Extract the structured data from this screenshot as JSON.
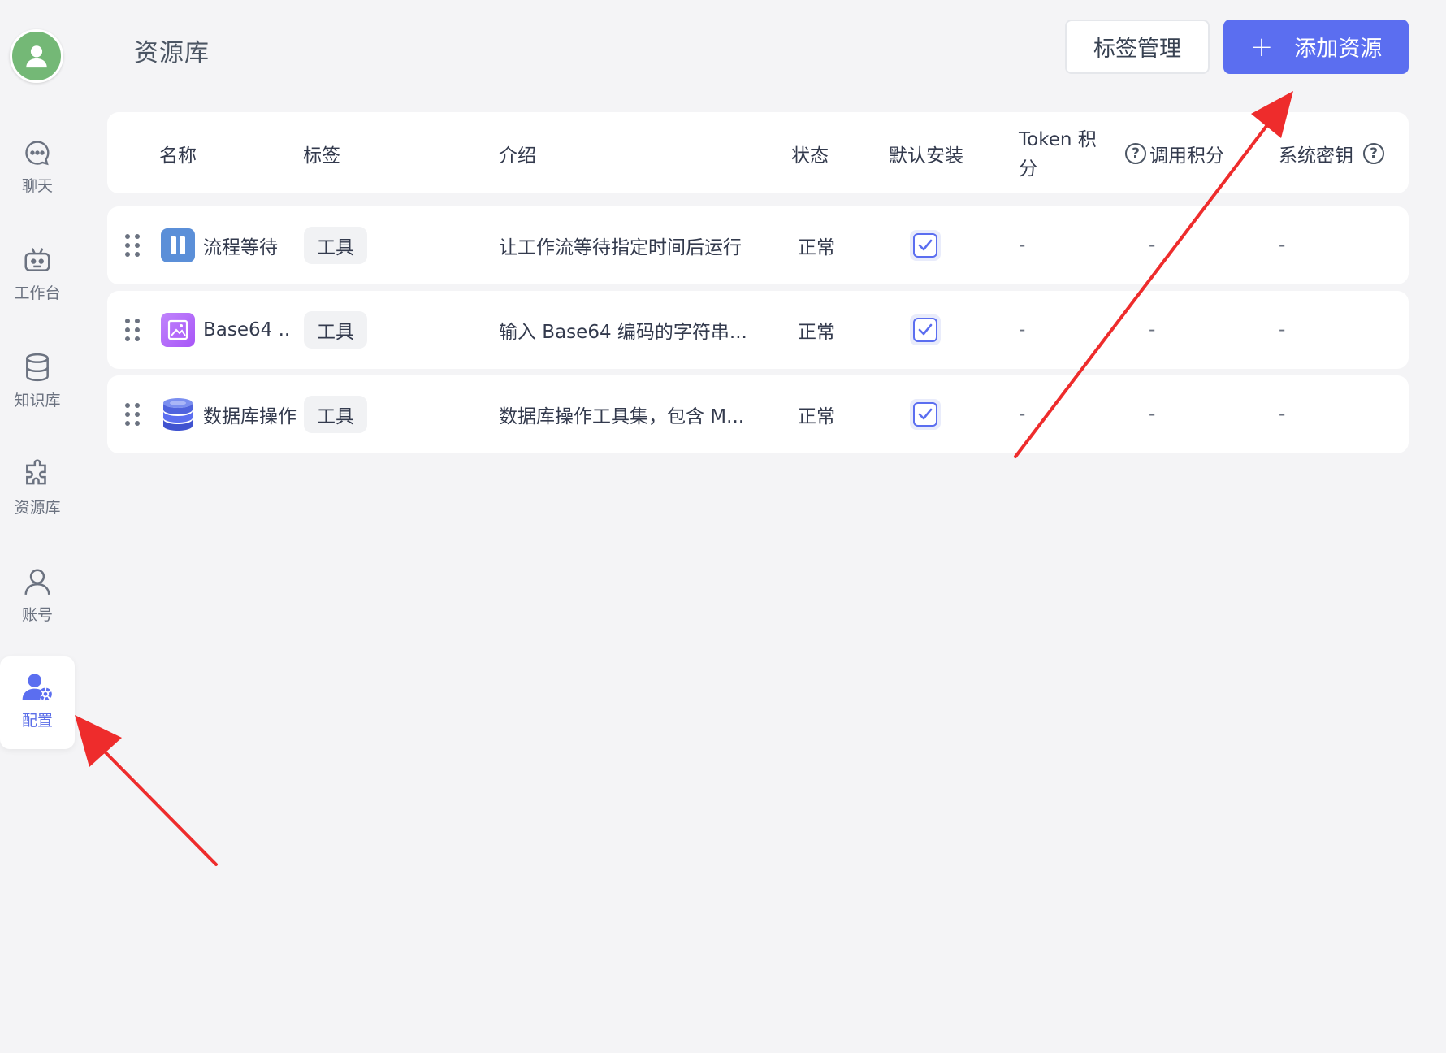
{
  "sidebar": {
    "items": [
      {
        "label": "聊天",
        "icon": "chat-bubble-icon"
      },
      {
        "label": "工作台",
        "icon": "robot-icon"
      },
      {
        "label": "知识库",
        "icon": "database-icon"
      },
      {
        "label": "资源库",
        "icon": "puzzle-icon"
      },
      {
        "label": "账号",
        "icon": "user-icon"
      },
      {
        "label": "配置",
        "icon": "user-gear-icon",
        "active": true
      }
    ]
  },
  "header": {
    "title": "资源库",
    "tags_button": "标签管理",
    "add_button_plus": "+",
    "add_button": "添加资源"
  },
  "table": {
    "columns": {
      "name": "名称",
      "tags": "标签",
      "intro": "介绍",
      "status": "状态",
      "default_install": "默认安装",
      "token_points": "Token 积分",
      "call_points": "调用积分",
      "system_key": "系统密钥"
    },
    "rows": [
      {
        "name": "流程等待",
        "icon": "pause-icon",
        "tag": "工具",
        "intro": "让工作流等待指定时间后运行",
        "status": "正常",
        "default_install": true,
        "token": "-",
        "call": "-",
        "key": "-"
      },
      {
        "name": "Base64 ...",
        "icon": "image-icon",
        "tag": "工具",
        "intro": "输入 Base64 编码的字符串...",
        "status": "正常",
        "default_install": true,
        "token": "-",
        "call": "-",
        "key": "-"
      },
      {
        "name": "数据库操作",
        "icon": "database-stack-icon",
        "tag": "工具",
        "intro": "数据库操作工具集，包含 M...",
        "status": "正常",
        "default_install": true,
        "token": "-",
        "call": "-",
        "key": "-"
      }
    ]
  },
  "colors": {
    "accent": "#5b6ef0",
    "annotation_arrow": "#ee2c2c",
    "avatar": "#74b876"
  }
}
